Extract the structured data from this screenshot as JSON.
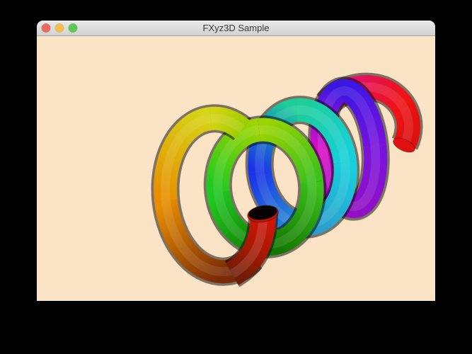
{
  "window": {
    "title": "FXyz3D Sample",
    "controls": [
      {
        "name": "close",
        "color": "#EC6A5E"
      },
      {
        "name": "minimize",
        "color": "#F5BF4F"
      },
      {
        "name": "zoom",
        "color": "#61C754"
      }
    ],
    "titlebar": {
      "bg_top": "#EAEAEA",
      "bg_bottom": "#D2D2D2",
      "border": "#A6A6A6",
      "text_color": "#3A3A3A"
    }
  },
  "scene": {
    "background": "#FBE3C6",
    "description": "3D rainbow spring (helical torus) sample rendering",
    "coils": {
      "A": {
        "c_start": "#5E1E06",
        "c0": "#7A2A06",
        "c1": "#E88E00",
        "c2": "#D6D414",
        "c3": "#A0CE00"
      },
      "B": {
        "c0": "#137800",
        "c1": "#1FC822",
        "c2": "#9CD400",
        "c3": "#3CC01C"
      },
      "C": {
        "c0": "#2C9CCC",
        "c1": "#1A35E8",
        "c2": "#1CCE98",
        "c3": "#16D0DC"
      },
      "D": {
        "c0": "#9110C6",
        "c1": "#D810C6",
        "c2": "#3A16E4",
        "c3": "#7712DC"
      },
      "E": {
        "c0": "#DA1288",
        "c1": "#E81240",
        "c2": "#EE1414",
        "c3": "#DE1010",
        "cap": "#E11010"
      }
    },
    "start_tube": {
      "c0": "#D41505",
      "c1": "#A51A04",
      "c2": "#6E1C06",
      "cap_rim": "#C21505",
      "cap_hole": "#070403"
    }
  },
  "page": {
    "background": "#000000"
  }
}
